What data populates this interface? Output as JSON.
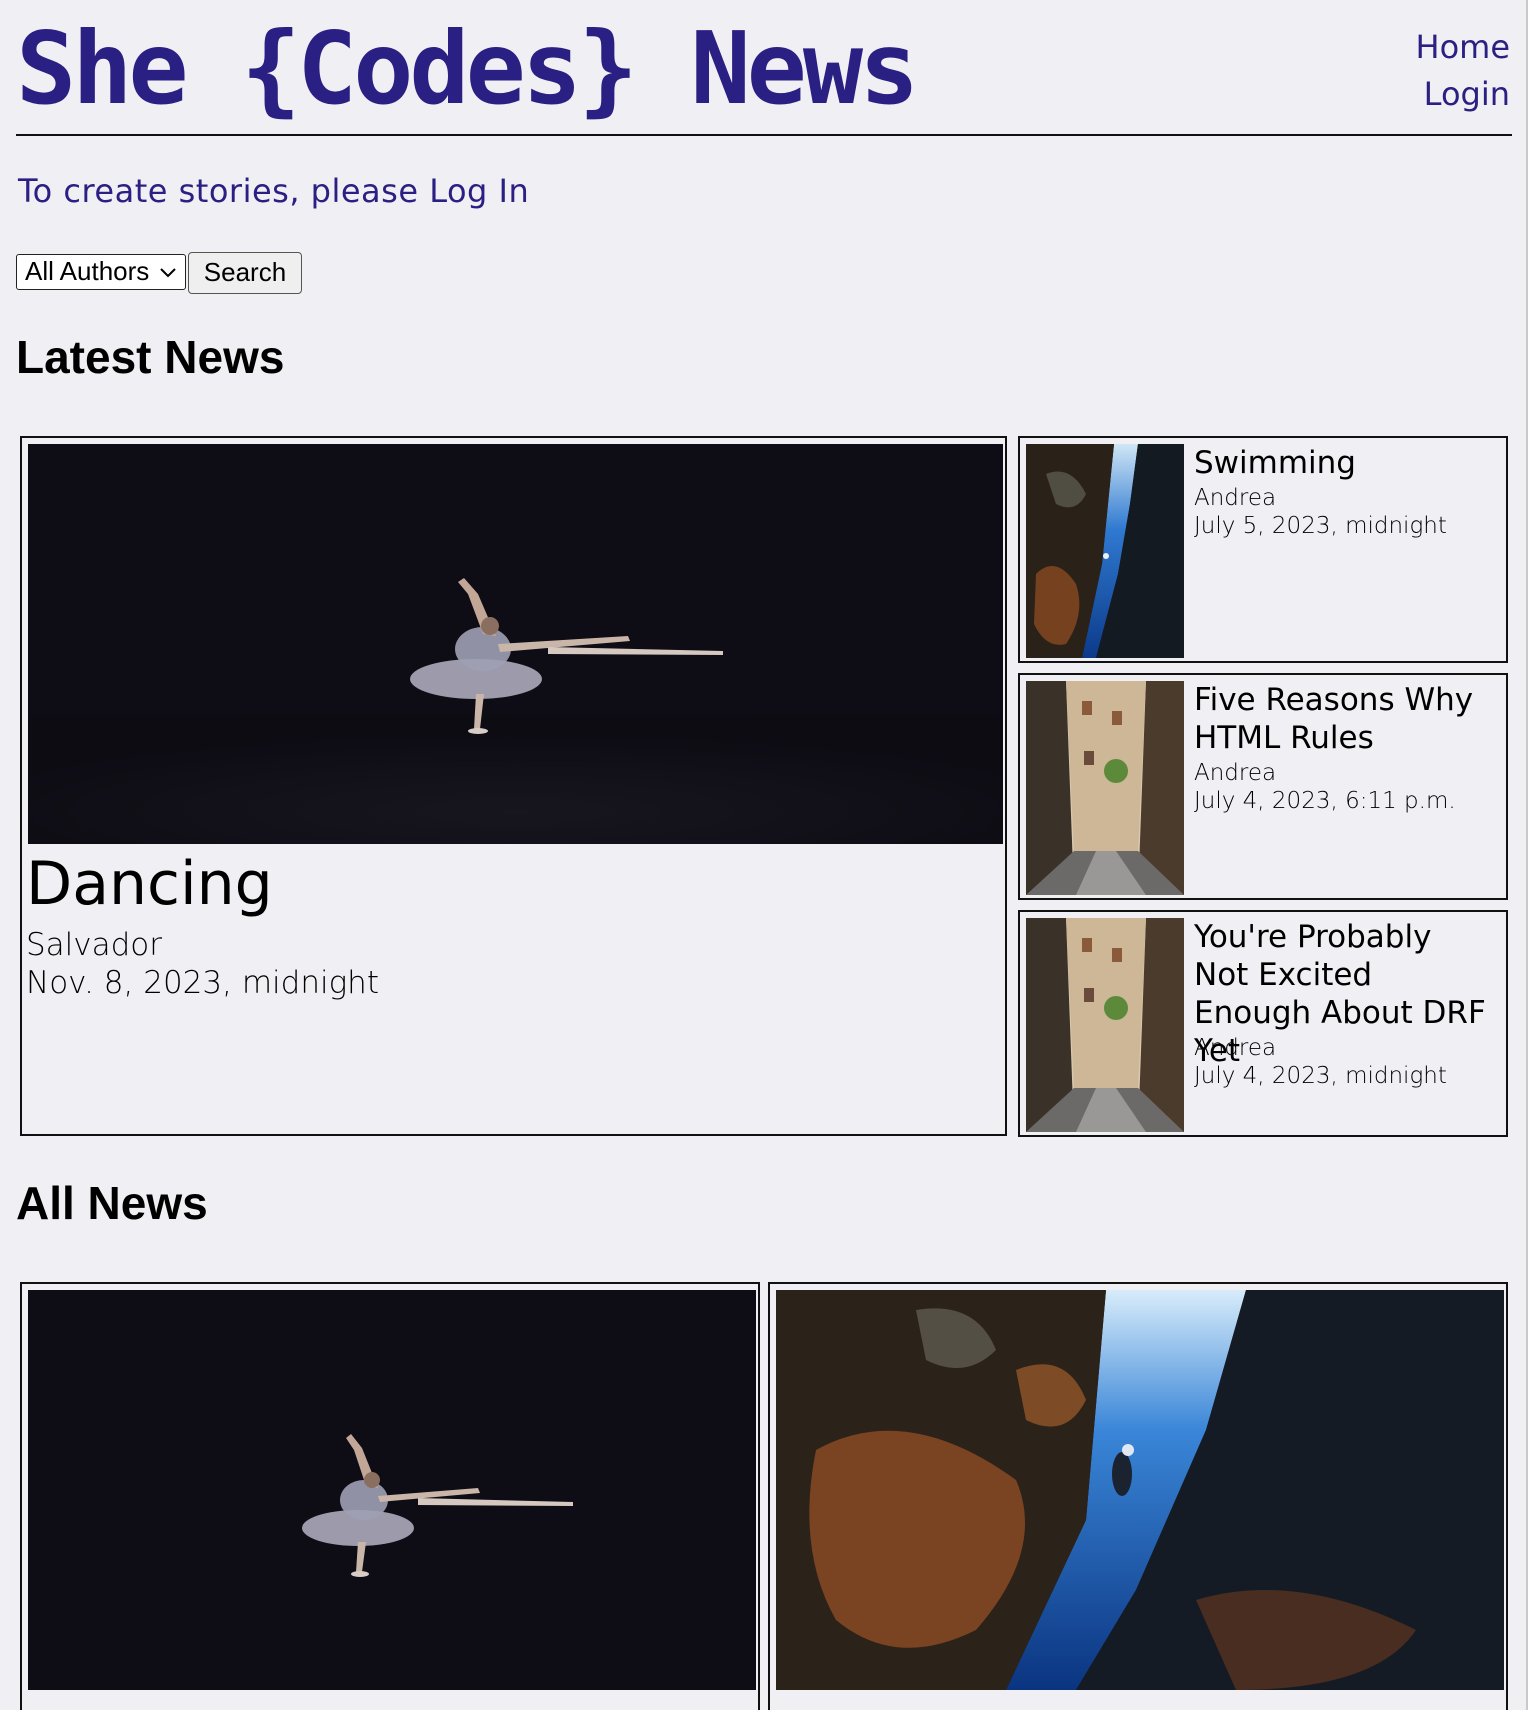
{
  "header": {
    "brand": "She {Codes} News",
    "nav": [
      {
        "label": "Home"
      },
      {
        "label": "Login"
      }
    ]
  },
  "notice": "To create stories, please Log In",
  "filter": {
    "selected_author": "All Authors",
    "search_label": "Search"
  },
  "latest": {
    "heading": "Latest News",
    "featured": {
      "title": "Dancing",
      "author": "Salvador",
      "date": "Nov. 8, 2023, midnight"
    },
    "side": [
      {
        "title": "Swimming",
        "author": "Andrea",
        "date": "July 5, 2023, midnight"
      },
      {
        "title": "Five Reasons Why HTML Rules",
        "author": "Andrea",
        "date": "July 4, 2023, 6:11 p.m."
      },
      {
        "title": "You're Probably Not Excited Enough About DRF Yet",
        "author": "Andrea",
        "date": "July 4, 2023, midnight"
      }
    ]
  },
  "all": {
    "heading": "All News"
  },
  "colors": {
    "brand": "#2a1f82",
    "page_bg": "#f0eff3",
    "image_dark": "#0e0c14"
  },
  "icons": [
    "chevron-down-icon"
  ]
}
